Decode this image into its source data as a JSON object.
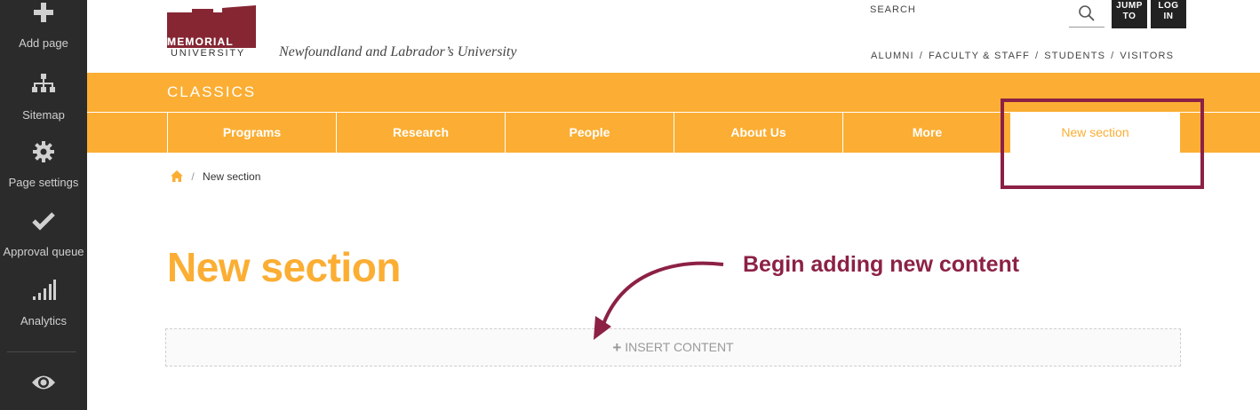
{
  "cms_sidebar": {
    "items": [
      {
        "label": "Add page",
        "icon": "plus-icon"
      },
      {
        "label": "Sitemap",
        "icon": "sitemap-icon"
      },
      {
        "label": "Page settings",
        "icon": "gear-icon"
      },
      {
        "label": "Approval queue",
        "icon": "checkmark-icon"
      },
      {
        "label": "Analytics",
        "icon": "analytics-bars-icon"
      }
    ],
    "preview_icon": "eye-icon"
  },
  "header": {
    "logo_line1": "MEMORIAL",
    "logo_line2": "UNIVERSITY",
    "tagline": "Newfoundland and Labrador’s University",
    "search_label": "SEARCH",
    "jump_to_line1": "JUMP",
    "jump_to_line2": "TO",
    "login_line1": "LOG",
    "login_line2": "IN",
    "audience_links": [
      "ALUMNI",
      "FACULTY & STAFF",
      "STUDENTS",
      "VISITORS"
    ],
    "audience_separators": [
      "/",
      "/",
      "/"
    ]
  },
  "department": {
    "title": "CLASSICS"
  },
  "nav": {
    "items": [
      "Programs",
      "Research",
      "People",
      "About Us",
      "More",
      "New section"
    ],
    "active": "New section"
  },
  "breadcrumb": {
    "separator": "/",
    "current": "New section"
  },
  "page": {
    "title": "New section",
    "insert_plus": "+",
    "insert_label": "INSERT CONTENT"
  },
  "annotation": {
    "text": "Begin adding new content",
    "color": "#8c2145"
  },
  "colors": {
    "brand_orange": "#fbae33",
    "brand_maroon": "#862633",
    "sidebar_bg": "#2b2b2b"
  }
}
